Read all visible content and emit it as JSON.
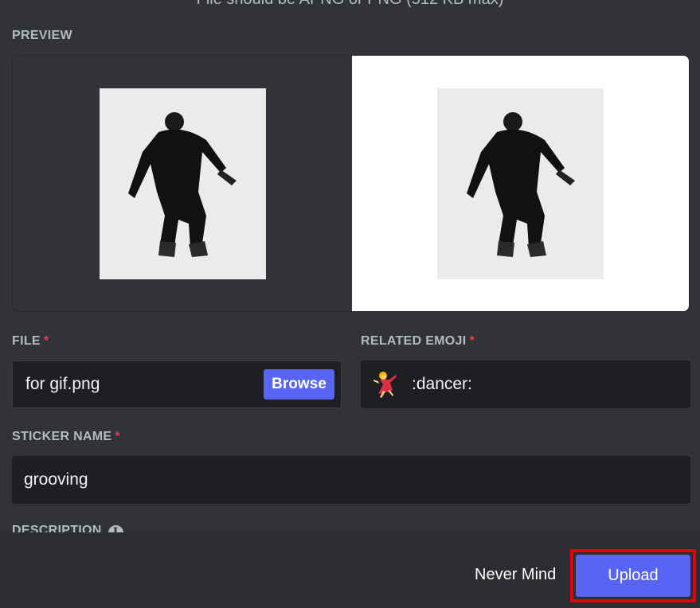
{
  "hint": "File should be APNG or PNG (512 KB max)",
  "preview": {
    "label": "PREVIEW"
  },
  "file": {
    "label": "FILE",
    "required_mark": "*",
    "value": "for gif.png",
    "browse_label": "Browse"
  },
  "emoji": {
    "label": "RELATED EMOJI",
    "required_mark": "*",
    "icon": "dancer-emoji",
    "value": ":dancer:"
  },
  "sticker_name": {
    "label": "STICKER NAME",
    "required_mark": "*",
    "value": "grooving"
  },
  "description": {
    "label": "DESCRIPTION",
    "info_icon": "info-icon"
  },
  "footer": {
    "cancel_label": "Never Mind",
    "upload_label": "Upload"
  },
  "colors": {
    "accent": "#5865f2",
    "highlight": "#e3000f",
    "required": "#f23f43"
  }
}
